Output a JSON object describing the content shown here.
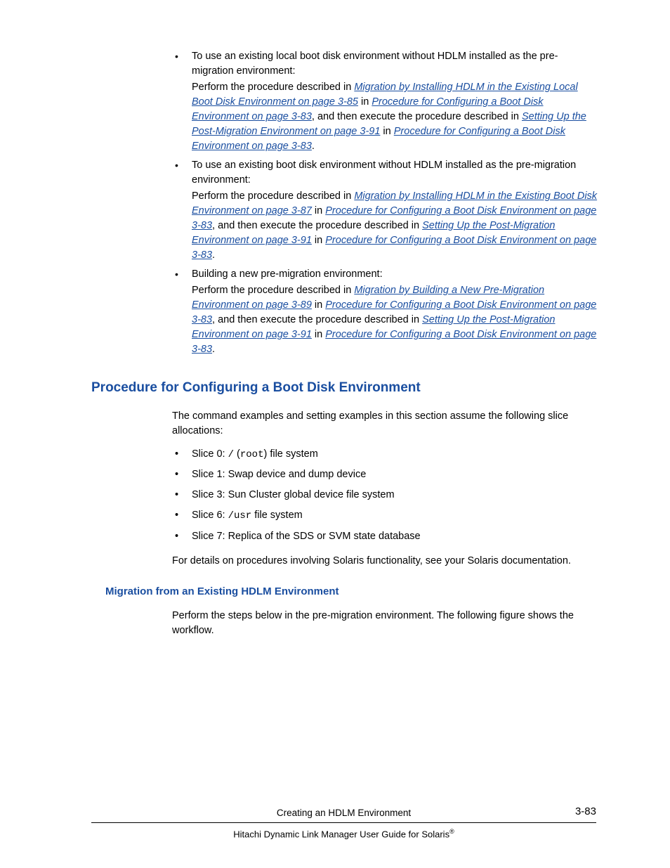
{
  "bullets": [
    {
      "lead": "To use an existing local boot disk environment without HDLM installed as the pre-migration environment:",
      "intro": "Perform the procedure described in ",
      "link1": "Migration by Installing HDLM in the Existing Local Boot Disk Environment on page 3-85",
      "t_in1": " in ",
      "link2": "Procedure for Configuring a Boot Disk Environment on page 3-83",
      "mid": ", and then execute the procedure described in ",
      "link3": "Setting Up the Post-Migration Environment on page 3-91",
      "t_in2": " in ",
      "link4": "Procedure for Configuring a Boot Disk Environment on page 3-83",
      "end": "."
    },
    {
      "lead": "To use an existing boot disk environment without HDLM installed as the pre-migration environment:",
      "intro": "Perform the procedure described in ",
      "link1": "Migration by Installing HDLM in the Existing Boot Disk Environment on page 3-87",
      "t_in1": " in ",
      "link2": "Procedure for Configuring a Boot Disk Environment on page 3-83",
      "mid": ", and then execute the procedure described in ",
      "link3": "Setting Up the Post-Migration Environment on page 3-91",
      "t_in2": " in ",
      "link4": "Procedure for Configuring a Boot Disk Environment on page 3-83",
      "end": "."
    },
    {
      "lead": "Building a new pre-migration environment:",
      "intro": "Perform the procedure described in ",
      "link1": "Migration by Building a New Pre-Migration Environment on page 3-89",
      "t_in1": " in ",
      "link2": "Procedure for Configuring a Boot Disk Environment on page 3-83",
      "mid": ", and then execute the procedure described in ",
      "link3": "Setting Up the Post-Migration Environment on page 3-91",
      "t_in2": " in ",
      "link4": "Procedure for Configuring a Boot Disk Environment on page 3-83",
      "end": "."
    }
  ],
  "section_heading": "Procedure for Configuring a Boot Disk Environment",
  "section_intro": "The command examples and setting examples in this section assume the following slice allocations:",
  "slices": [
    {
      "pre": "Slice 0: ",
      "mono": "/",
      "paren_open": " (",
      "mono2": "root",
      "paren_close": ") file system"
    },
    {
      "pre": "Slice 1: Swap device and dump device"
    },
    {
      "pre": "Slice 3: Sun Cluster global device file system"
    },
    {
      "pre": "Slice 6: ",
      "mono": "/usr",
      "after": " file system"
    },
    {
      "pre": "Slice 7: Replica of the SDS or SVM state database"
    }
  ],
  "section_after": "For details on procedures involving Solaris functionality, see your Solaris documentation.",
  "subsection_heading": "Migration from an Existing HDLM Environment",
  "subsection_text": "Perform the steps below in the pre-migration environment. The following figure shows the workflow.",
  "footer": {
    "chapter": "Creating an HDLM Environment",
    "page": "3-83",
    "doc_title_pre": "Hitachi Dynamic Link Manager User Guide for Solaris",
    "reg": "®"
  }
}
